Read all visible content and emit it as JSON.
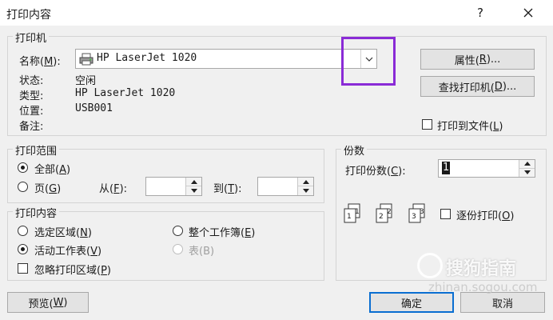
{
  "dialog": {
    "title": "打印内容",
    "help_glyph": "?",
    "close_glyph": "✕"
  },
  "printer": {
    "group_label": "打印机",
    "name_label": "名称(",
    "name_key": "M",
    "name_label_end": "):",
    "selected": "HP LaserJet 1020",
    "status_label": "状态:",
    "status_value": "空闲",
    "type_label": "类型:",
    "type_value": "HP LaserJet 1020",
    "location_label": "位置:",
    "location_value": "USB001",
    "comment_label": "备注:",
    "properties_button": "属性(",
    "properties_key": "R",
    "properties_end": ")...",
    "find_button": "查找打印机(",
    "find_key": "D",
    "find_end": ")...",
    "print_to_file": "打印到文件(",
    "print_to_file_key": "L",
    "print_to_file_end": ")",
    "print_to_file_checked": false
  },
  "range": {
    "group_label": "打印范围",
    "all_label": "全部(",
    "all_key": "A",
    "all_end": ")",
    "all_selected": true,
    "pages_label": "页(",
    "pages_key": "G",
    "pages_end": ")",
    "from_label": "从(",
    "from_key": "F",
    "from_end": "):",
    "from_value": "",
    "to_label": "到(",
    "to_key": "T",
    "to_end": "):",
    "to_value": ""
  },
  "content": {
    "group_label": "打印内容",
    "selection_label": "选定区域(",
    "selection_key": "N",
    "selection_end": ")",
    "whole_workbook_label": "整个工作簿(",
    "whole_workbook_key": "E",
    "whole_workbook_end": ")",
    "active_sheet_label": "活动工作表(",
    "active_sheet_key": "V",
    "active_sheet_end": ")",
    "active_sheet_selected": true,
    "table_label": "表(B)",
    "ignore_area_label": "忽略打印区域(",
    "ignore_area_key": "P",
    "ignore_area_end": ")",
    "ignore_area_checked": false
  },
  "copies": {
    "group_label": "份数",
    "count_label": "打印份数(",
    "count_key": "C",
    "count_end": "):",
    "count_value": "1",
    "collate_label": "逐份打印(",
    "collate_key": "O",
    "collate_end": ")",
    "collate_checked": false,
    "icon_pages": [
      "1",
      "1",
      "2",
      "2",
      "3",
      "3"
    ]
  },
  "footer": {
    "preview_label": "预览(",
    "preview_key": "W",
    "preview_end": ")",
    "ok_label": "确定",
    "cancel_label": "取消"
  },
  "watermark": {
    "text": "搜狗指南",
    "url": "zhinan.sogou.com"
  },
  "colors": {
    "highlight": "#8a2bd6",
    "primary_border": "#0a6ed1"
  }
}
